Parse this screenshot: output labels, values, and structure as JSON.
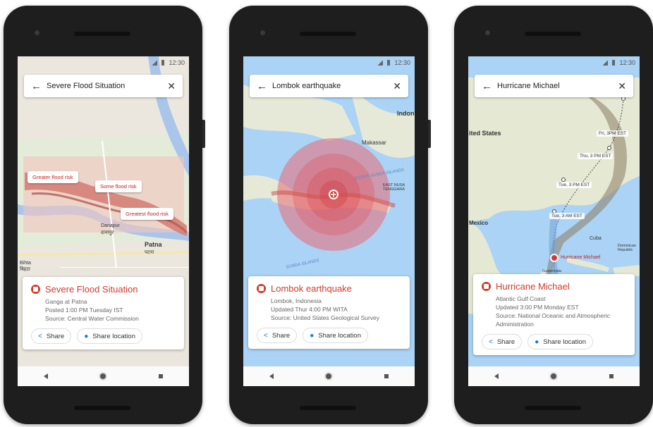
{
  "status_time": "12:30",
  "phones": [
    {
      "id": "flood",
      "search_text": "Severe Flood Situation",
      "card": {
        "title": "Severe Flood Situation",
        "lines": [
          "Ganga at Patna",
          "Posted 1:00 PM Tuesday IST",
          "Source: Central Water Commission"
        ],
        "share_label": "Share",
        "share_location_label": "Share location"
      },
      "map_labels": {
        "greater": "Greater flood risk",
        "some": "Some flood risk",
        "greatest": "Greatest flood risk",
        "danapur": "Danapur",
        "danapur_local": "दानापुर",
        "patna": "Patna",
        "patna_local": "पटना",
        "bihta": "Bihta",
        "bihta_local": "बिहटा"
      }
    },
    {
      "id": "earthquake",
      "search_text": "Lombok earthquake",
      "card": {
        "title": "Lombok earthquake",
        "lines": [
          "Lombok, Indonesia",
          "Updated Thur 4:00 PM WITA",
          "Source: United States Geological Survey"
        ],
        "share_label": "Share",
        "share_location_label": "Share location"
      },
      "map_labels": {
        "indonesia": "Indone",
        "makassar": "Makassar",
        "lesser_sunda": "LESSER SUNDA ISLANDS",
        "east_nusa": "EAST NUSA TENGGARA",
        "sunda_islands": "SUNDA ISLANDS"
      }
    },
    {
      "id": "hurricane",
      "search_text": "Hurricane Michael",
      "card": {
        "title": "Hurricane Michael",
        "lines": [
          "Atlantic Gulf Coast",
          "Updated 3:00 PM Monday EST",
          "Source: National Oceanic and Atmospheric Administration"
        ],
        "share_label": "Share",
        "share_location_label": "Share location"
      },
      "map_labels": {
        "us": "ited States",
        "mexico": "Mexico",
        "cuba": "Cuba",
        "dominican": "Dominican Republic",
        "guatemala": "Guatemala",
        "fri": "Fri, 3PM EST",
        "thu": "Thu, 3 PM EST",
        "tue3pm": "Tue, 3 PM EST",
        "tue3am": "Tue, 3 AM EST",
        "marker": "Hurricane Michael"
      }
    }
  ]
}
